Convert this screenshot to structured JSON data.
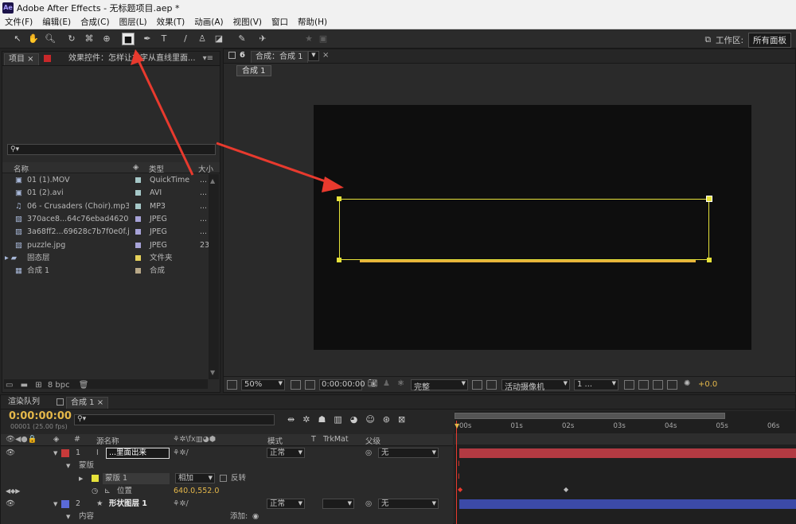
{
  "app": {
    "title": "Adobe After Effects - 无标题项目.aep *",
    "logo": "Ae"
  },
  "menu": [
    "文件(F)",
    "编辑(E)",
    "合成(C)",
    "图层(L)",
    "效果(T)",
    "动画(A)",
    "视图(V)",
    "窗口",
    "帮助(H)"
  ],
  "toolbar": {
    "tools": [
      "selection-tool-icon",
      "hand-tool-icon",
      "zoom-tool-icon",
      "rotate-tool-icon",
      "orbit-camera-icon",
      "pan-behind-icon",
      "rectangle-tool-icon",
      "pen-tool-icon",
      "type-tool-icon",
      "brush-tool-icon",
      "clone-stamp-icon",
      "eraser-tool-icon",
      "roto-brush-icon",
      "puppet-pin-icon"
    ],
    "workspace_label": "工作区:",
    "workspace_value": "所有面板"
  },
  "project_panel": {
    "tab_project": "项目",
    "tab_effects": "效果控件：怎样让文字从直线里面...",
    "search_placeholder": "",
    "col_name": "名称",
    "col_type": "类型",
    "col_size": "大小",
    "items": [
      {
        "name": "01 (1).MOV",
        "type": "QuickTime",
        "size": "...",
        "label_color": "#a6c8c8",
        "icon": "video-file-icon"
      },
      {
        "name": "01 (2).avi",
        "type": "AVI",
        "size": "...",
        "label_color": "#a6c8c8",
        "icon": "video-file-icon"
      },
      {
        "name": "06 - Crusaders (Choir).mp3",
        "type": "MP3",
        "size": "...",
        "label_color": "#a6c8c8",
        "icon": "audio-file-icon"
      },
      {
        "name": "370ace8...64c76ebad4620.jpg",
        "type": "JPEG",
        "size": "...",
        "label_color": "#a7a3d8",
        "icon": "image-file-icon"
      },
      {
        "name": "3a68ff2...69628c7b7f0e0f.jpg",
        "type": "JPEG",
        "size": "...",
        "label_color": "#a7a3d8",
        "icon": "image-file-icon"
      },
      {
        "name": "puzzle.jpg",
        "type": "JPEG",
        "size": "23",
        "label_color": "#a7a3d8",
        "icon": "image-file-icon"
      },
      {
        "name": "固态层",
        "type": "文件夹",
        "size": "",
        "label_color": "#e6d25a",
        "icon": "folder-icon"
      },
      {
        "name": "合成 1",
        "type": "合成",
        "size": "",
        "label_color": "#b8a888",
        "icon": "composition-icon"
      }
    ],
    "bpc": "8 bpc"
  },
  "comp_panel": {
    "tab_title": "合成：合成 1",
    "breadcrumb": "合成 1",
    "zoom": "50%",
    "timecode": "0:00:00:00",
    "resolution": "完整",
    "camera": "活动摄像机",
    "views": "1 ...",
    "exposure": "+0.0"
  },
  "timeline": {
    "tab_render": "渲染队列",
    "tab_comp": "合成 1",
    "timecode": "0:00:00:00",
    "fps": "00001 (25.00 fps)",
    "search_placeholder": "",
    "col_source": "源名称",
    "col_mode": "模式",
    "col_t": "T",
    "col_trkmat": "TrkMat",
    "col_parent": "父级",
    "ruler": [
      "00s",
      "01s",
      "02s",
      "03s",
      "04s",
      "05s",
      "06s"
    ],
    "layers": [
      {
        "num": "1",
        "name": "...里面出来",
        "mode": "正常",
        "parent": "无",
        "color": "#c83a3a"
      },
      {
        "num": "2",
        "name": "形状图层 1",
        "mode": "正常",
        "parent": "无",
        "color": "#5a6ad8"
      }
    ],
    "mask_group": "蒙版",
    "mask_name": "蒙版 1",
    "mask_mode": "相加",
    "invert": "反转",
    "position_label": "位置",
    "position_value": "640.0,552.0",
    "contents": "内容",
    "add": "添加:"
  },
  "colors": {
    "mask_yellow": "#e6e23a",
    "shape_line": "#e6b33a",
    "arrow_red": "#e83a2e",
    "timeline_red": "#b33a42",
    "timeline_blue": "#3c4aa8"
  }
}
